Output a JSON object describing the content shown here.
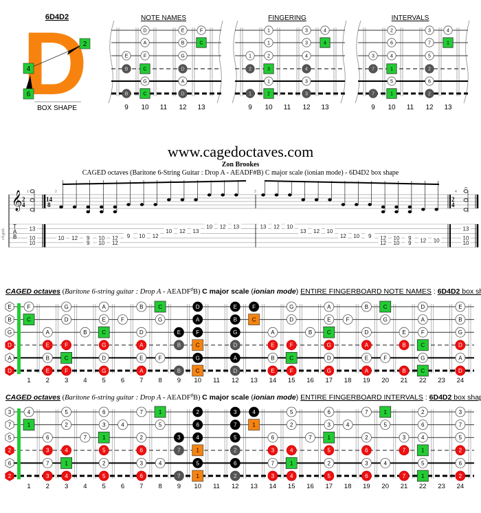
{
  "box_shape": {
    "code": "6D4D2",
    "caption": "BOX SHAPE",
    "letter": "D",
    "markers": [
      "2",
      "4",
      "6"
    ],
    "letter_color": "#F7830E",
    "marker_color": "#22CC33"
  },
  "mini_boards": {
    "fret_labels": [
      "9",
      "10",
      "11",
      "12",
      "13"
    ],
    "frets": [
      9,
      10,
      11,
      12,
      13
    ],
    "boards": [
      {
        "title": "NOTE NAMES",
        "notes": [
          {
            "string": 1,
            "fret": 10,
            "label": "D",
            "kind": "white"
          },
          {
            "string": 1,
            "fret": 12,
            "label": "E",
            "kind": "white"
          },
          {
            "string": 1,
            "fret": 13,
            "label": "F",
            "kind": "white"
          },
          {
            "string": 2,
            "fret": 10,
            "label": "A",
            "kind": "white"
          },
          {
            "string": 2,
            "fret": 12,
            "label": "B",
            "kind": "white"
          },
          {
            "string": 2,
            "fret": 13,
            "label": "C",
            "kind": "root"
          },
          {
            "string": 3,
            "fret": 9,
            "label": "E",
            "kind": "white"
          },
          {
            "string": 3,
            "fret": 10,
            "label": "F",
            "kind": "white"
          },
          {
            "string": 3,
            "fret": 12,
            "label": "G",
            "kind": "white"
          },
          {
            "string": 4,
            "fret": 9,
            "label": "B",
            "kind": "dark"
          },
          {
            "string": 4,
            "fret": 10,
            "label": "C",
            "kind": "root"
          },
          {
            "string": 4,
            "fret": 12,
            "label": "D",
            "kind": "dark"
          },
          {
            "string": 5,
            "fret": 10,
            "label": "G",
            "kind": "white"
          },
          {
            "string": 5,
            "fret": 12,
            "label": "A",
            "kind": "white"
          },
          {
            "string": 6,
            "fret": 9,
            "label": "B",
            "kind": "dark"
          },
          {
            "string": 6,
            "fret": 10,
            "label": "C",
            "kind": "root"
          },
          {
            "string": 6,
            "fret": 12,
            "label": "D",
            "kind": "dark"
          }
        ]
      },
      {
        "title": "FINGERING",
        "notes": [
          {
            "string": 1,
            "fret": 10,
            "label": "1",
            "kind": "white"
          },
          {
            "string": 1,
            "fret": 12,
            "label": "3",
            "kind": "white"
          },
          {
            "string": 1,
            "fret": 13,
            "label": "4",
            "kind": "white"
          },
          {
            "string": 2,
            "fret": 10,
            "label": "1",
            "kind": "white"
          },
          {
            "string": 2,
            "fret": 12,
            "label": "3",
            "kind": "white"
          },
          {
            "string": 2,
            "fret": 13,
            "label": "4",
            "kind": "root"
          },
          {
            "string": 3,
            "fret": 9,
            "label": "1",
            "kind": "white"
          },
          {
            "string": 3,
            "fret": 10,
            "label": "2",
            "kind": "white"
          },
          {
            "string": 3,
            "fret": 12,
            "label": "4",
            "kind": "white"
          },
          {
            "string": 4,
            "fret": 9,
            "label": "2",
            "kind": "dark"
          },
          {
            "string": 4,
            "fret": 10,
            "label": "3",
            "kind": "root"
          },
          {
            "string": 4,
            "fret": 12,
            "label": "4",
            "kind": "dark"
          },
          {
            "string": 5,
            "fret": 10,
            "label": "1",
            "kind": "white"
          },
          {
            "string": 5,
            "fret": 12,
            "label": "3",
            "kind": "white"
          },
          {
            "string": 6,
            "fret": 9,
            "label": "1",
            "kind": "dark"
          },
          {
            "string": 6,
            "fret": 10,
            "label": "2",
            "kind": "root"
          },
          {
            "string": 6,
            "fret": 12,
            "label": "3",
            "kind": "dark"
          }
        ]
      },
      {
        "title": "INTERVALS",
        "notes": [
          {
            "string": 1,
            "fret": 10,
            "label": "2",
            "kind": "white"
          },
          {
            "string": 1,
            "fret": 12,
            "label": "3",
            "kind": "white"
          },
          {
            "string": 1,
            "fret": 13,
            "label": "4",
            "kind": "white"
          },
          {
            "string": 2,
            "fret": 10,
            "label": "6",
            "kind": "white"
          },
          {
            "string": 2,
            "fret": 12,
            "label": "7",
            "kind": "white"
          },
          {
            "string": 2,
            "fret": 13,
            "label": "1",
            "kind": "root"
          },
          {
            "string": 3,
            "fret": 9,
            "label": "3",
            "kind": "white"
          },
          {
            "string": 3,
            "fret": 10,
            "label": "4",
            "kind": "white"
          },
          {
            "string": 3,
            "fret": 12,
            "label": "5",
            "kind": "white"
          },
          {
            "string": 4,
            "fret": 9,
            "label": "7",
            "kind": "dark"
          },
          {
            "string": 4,
            "fret": 10,
            "label": "1",
            "kind": "root"
          },
          {
            "string": 4,
            "fret": 12,
            "label": "2",
            "kind": "dark"
          },
          {
            "string": 5,
            "fret": 10,
            "label": "5",
            "kind": "white"
          },
          {
            "string": 5,
            "fret": 12,
            "label": "6",
            "kind": "white"
          },
          {
            "string": 6,
            "fret": 9,
            "label": "7",
            "kind": "dark"
          },
          {
            "string": 6,
            "fret": 10,
            "label": "1",
            "kind": "root"
          },
          {
            "string": 6,
            "fret": 12,
            "label": "2",
            "kind": "dark"
          }
        ]
      }
    ]
  },
  "header": {
    "site": "www.cagedoctaves.com",
    "author": "Zon Brookes",
    "subtitle": "CAGED octaves (Baritone 6-String Guitar : Drop A - AEADF#B) C major scale (ionian mode) - 6D4D2 box shape"
  },
  "score": {
    "instrument_label": "cd.guit.",
    "measure_numbers": [
      "1",
      "2",
      "3",
      "4"
    ],
    "time_sig_1": [
      "2",
      "4"
    ],
    "time_sig_2": [
      "14",
      "8"
    ],
    "time_sig_3": [
      "2",
      "4"
    ],
    "tab_letters": [
      "T",
      "A",
      "B"
    ],
    "tab_events": [
      {
        "measure": 1,
        "notes": [
          {
            "s": 1,
            "f": "13"
          },
          {
            "s": 3,
            "f": "10"
          },
          {
            "s": 4,
            "f": "10"
          }
        ]
      },
      {
        "measure": 2,
        "notes": [
          {
            "s": 3,
            "f": "10"
          }
        ]
      },
      {
        "measure": 2,
        "notes": [
          {
            "s": 3,
            "f": "12"
          }
        ]
      },
      {
        "measure": 2,
        "notes": [
          {
            "s": 3,
            "f": "9"
          },
          {
            "s": 4,
            "f": "9"
          }
        ]
      },
      {
        "measure": 2,
        "notes": [
          {
            "s": 3,
            "f": "10"
          },
          {
            "s": 4,
            "f": "10"
          }
        ]
      },
      {
        "measure": 2,
        "notes": [
          {
            "s": 3,
            "f": "12"
          },
          {
            "s": 4,
            "f": "12"
          }
        ]
      },
      {
        "measure": 2,
        "notes": [
          {
            "s": 2.5,
            "f": "9"
          }
        ]
      },
      {
        "measure": 2,
        "notes": [
          {
            "s": 2.5,
            "f": "10"
          }
        ]
      },
      {
        "measure": 2,
        "notes": [
          {
            "s": 2.5,
            "f": "12"
          }
        ]
      },
      {
        "measure": 2,
        "notes": [
          {
            "s": 1.5,
            "f": "10"
          }
        ]
      },
      {
        "measure": 2,
        "notes": [
          {
            "s": 1.5,
            "f": "12"
          }
        ]
      },
      {
        "measure": 2,
        "notes": [
          {
            "s": 1.5,
            "f": "13"
          }
        ]
      },
      {
        "measure": 2,
        "notes": [
          {
            "s": 0.5,
            "f": "10"
          }
        ]
      },
      {
        "measure": 2,
        "notes": [
          {
            "s": 0.5,
            "f": "12"
          }
        ]
      },
      {
        "measure": 2,
        "notes": [
          {
            "s": 0.5,
            "f": "13"
          }
        ]
      },
      {
        "measure": 3,
        "notes": [
          {
            "s": 0.5,
            "f": "13"
          }
        ]
      },
      {
        "measure": 3,
        "notes": [
          {
            "s": 0.5,
            "f": "12"
          }
        ]
      },
      {
        "measure": 3,
        "notes": [
          {
            "s": 0.5,
            "f": "10"
          }
        ]
      },
      {
        "measure": 3,
        "notes": [
          {
            "s": 1.5,
            "f": "13"
          }
        ]
      },
      {
        "measure": 3,
        "notes": [
          {
            "s": 1.5,
            "f": "12"
          }
        ]
      },
      {
        "measure": 3,
        "notes": [
          {
            "s": 1.5,
            "f": "10"
          }
        ]
      },
      {
        "measure": 3,
        "notes": [
          {
            "s": 2.5,
            "f": "12"
          }
        ]
      },
      {
        "measure": 3,
        "notes": [
          {
            "s": 2.5,
            "f": "10"
          }
        ]
      },
      {
        "measure": 3,
        "notes": [
          {
            "s": 2.5,
            "f": "9"
          }
        ]
      },
      {
        "measure": 3,
        "notes": [
          {
            "s": 3,
            "f": "12"
          },
          {
            "s": 4,
            "f": "12"
          }
        ]
      },
      {
        "measure": 3,
        "notes": [
          {
            "s": 3,
            "f": "10"
          },
          {
            "s": 4,
            "f": "10"
          }
        ]
      },
      {
        "measure": 3,
        "notes": [
          {
            "s": 3,
            "f": "9"
          },
          {
            "s": 4,
            "f": "9"
          }
        ]
      },
      {
        "measure": 3,
        "notes": [
          {
            "s": 3.5,
            "f": "12"
          }
        ]
      },
      {
        "measure": 3,
        "notes": [
          {
            "s": 3.5,
            "f": "10"
          }
        ]
      },
      {
        "measure": 4,
        "notes": [
          {
            "s": 1,
            "f": "13"
          },
          {
            "s": 3,
            "f": "10"
          },
          {
            "s": 4,
            "f": "10"
          }
        ]
      }
    ]
  },
  "full_boards": {
    "fret_labels": [
      "1",
      "2",
      "3",
      "4",
      "5",
      "6",
      "7",
      "8",
      "9",
      "10",
      "11",
      "12",
      "13",
      "14",
      "15",
      "16",
      "17",
      "18",
      "19",
      "20",
      "21",
      "22",
      "23",
      "24"
    ],
    "boards": [
      {
        "title_parts": {
          "a": "CAGED octaves",
          "b": " (",
          "c": "Baritone 6-string guitar : Drop A",
          "d": " - AEADF",
          "sharp": "♯",
          "e": "B) ",
          "f": "C major scale",
          "g": " (",
          "h": "ionian mode",
          "i": ") ",
          "j": "ENTIRE FINGERBOARD NOTE NAMES",
          "k": " : ",
          "l": "6D4D2",
          "m": " box shape"
        },
        "open": [
          {
            "label": "E",
            "kind": "hex"
          },
          {
            "label": "B",
            "kind": "hex"
          },
          {
            "label": "G",
            "kind": "hex"
          },
          {
            "label": "D",
            "kind": "hexred"
          },
          {
            "label": "A",
            "kind": "hex"
          },
          {
            "label": "D",
            "kind": "hexred"
          }
        ],
        "rows": [
          {
            "1": "F",
            "3": "G",
            "5": "A",
            "7": "B",
            "8": "C*",
            "10": "D#",
            "12": "E#",
            "13": "F#",
            "15": "G",
            "17": "A",
            "19": "B",
            "20": "C*",
            "22": "D",
            "24": "E"
          },
          {
            "1": "C*",
            "3": "D",
            "5": "E",
            "6": "F",
            "8": "G",
            "10": "A#",
            "12": "B#",
            "13": "Co",
            "15": "D",
            "17": "E",
            "18": "F",
            "20": "G",
            "22": "A",
            "24": "B"
          },
          {
            "2": "A",
            "4": "B",
            "5": "C*",
            "7": "D",
            "9": "E#",
            "10": "F#",
            "12": "G#",
            "14": "A",
            "16": "B",
            "17": "C*",
            "19": "D",
            "21": "E",
            "22": "F",
            "24": "G"
          },
          {
            "2": "Er",
            "3": "Fr",
            "5": "Gr",
            "7": "Ar",
            "9": "B~",
            "10": "Co",
            "12": "D~",
            "14": "Er",
            "15": "Fr",
            "17": "Gr",
            "19": "Ar",
            "21": "Br",
            "22": "C*",
            "24": "Dr"
          },
          {
            "2": "B",
            "3": "C*",
            "5": "D",
            "7": "E",
            "8": "F",
            "10": "G#",
            "12": "A#",
            "14": "B",
            "15": "C*",
            "17": "D",
            "19": "E",
            "20": "F",
            "22": "G",
            "24": "A"
          },
          {
            "2": "Er",
            "3": "Fr",
            "5": "Gr",
            "7": "Ar",
            "9": "B~",
            "10": "Co",
            "12": "D~",
            "14": "Er",
            "15": "Fr",
            "17": "Gr",
            "19": "Ar",
            "21": "Br",
            "22": "C*",
            "24": "Dr"
          }
        ]
      },
      {
        "title_parts": {
          "a": "CAGED octaves",
          "b": " (",
          "c": "Baritone 6-string guitar : Drop A",
          "d": " - AEADF",
          "sharp": "♯",
          "e": "B) ",
          "f": "C major scale",
          "g": " (",
          "h": "ionian mode",
          "i": ") ",
          "j": "ENTIRE FINGERBOARD INTERVALS",
          "k": " : ",
          "l": "6D4D2",
          "m": " box shape"
        },
        "open": [
          {
            "label": "3",
            "kind": "hex"
          },
          {
            "label": "7",
            "kind": "hex"
          },
          {
            "label": "5",
            "kind": "hex"
          },
          {
            "label": "2",
            "kind": "hexred"
          },
          {
            "label": "6",
            "kind": "hex"
          },
          {
            "label": "2",
            "kind": "hexred"
          }
        ],
        "rows": [
          {
            "1": "4",
            "3": "5",
            "5": "6",
            "7": "7",
            "8": "1*",
            "10": "2#",
            "12": "3#",
            "13": "4#",
            "15": "5",
            "17": "6",
            "19": "7",
            "20": "1*",
            "22": "2",
            "24": "3"
          },
          {
            "1": "1*",
            "3": "2",
            "5": "3",
            "6": "4",
            "8": "5",
            "10": "6#",
            "12": "7#",
            "13": "1o",
            "15": "2",
            "17": "3",
            "18": "4",
            "20": "5",
            "22": "6",
            "24": "7"
          },
          {
            "2": "6",
            "4": "7",
            "5": "1*",
            "7": "2",
            "9": "3#",
            "10": "4#",
            "12": "5#",
            "14": "6",
            "16": "7",
            "17": "1*",
            "19": "2",
            "21": "3",
            "22": "4",
            "24": "5"
          },
          {
            "2": "3r",
            "3": "4r",
            "5": "5r",
            "7": "6r",
            "9": "7~",
            "10": "1o",
            "12": "2~",
            "14": "3r",
            "15": "4r",
            "17": "5r",
            "19": "6r",
            "21": "7r",
            "22": "1*",
            "24": "2r"
          },
          {
            "2": "7",
            "3": "1*",
            "5": "2",
            "7": "3",
            "8": "4",
            "10": "5#",
            "12": "6#",
            "14": "7",
            "15": "1*",
            "17": "2",
            "19": "3",
            "20": "4",
            "22": "5",
            "24": "6"
          },
          {
            "2": "3r",
            "3": "4r",
            "5": "5r",
            "7": "6r",
            "9": "7~",
            "10": "1o",
            "12": "2~",
            "14": "3r",
            "15": "4r",
            "17": "5r",
            "19": "6r",
            "21": "7r",
            "22": "1*",
            "24": "2r"
          }
        ]
      }
    ]
  },
  "colors": {
    "root_green": "#22CC33",
    "orange": "#F7830E",
    "red": "#EE1111",
    "black": "#000000",
    "dark_grey": "#555555",
    "fret_line": "#999999",
    "nut_green": "#22CC33"
  }
}
